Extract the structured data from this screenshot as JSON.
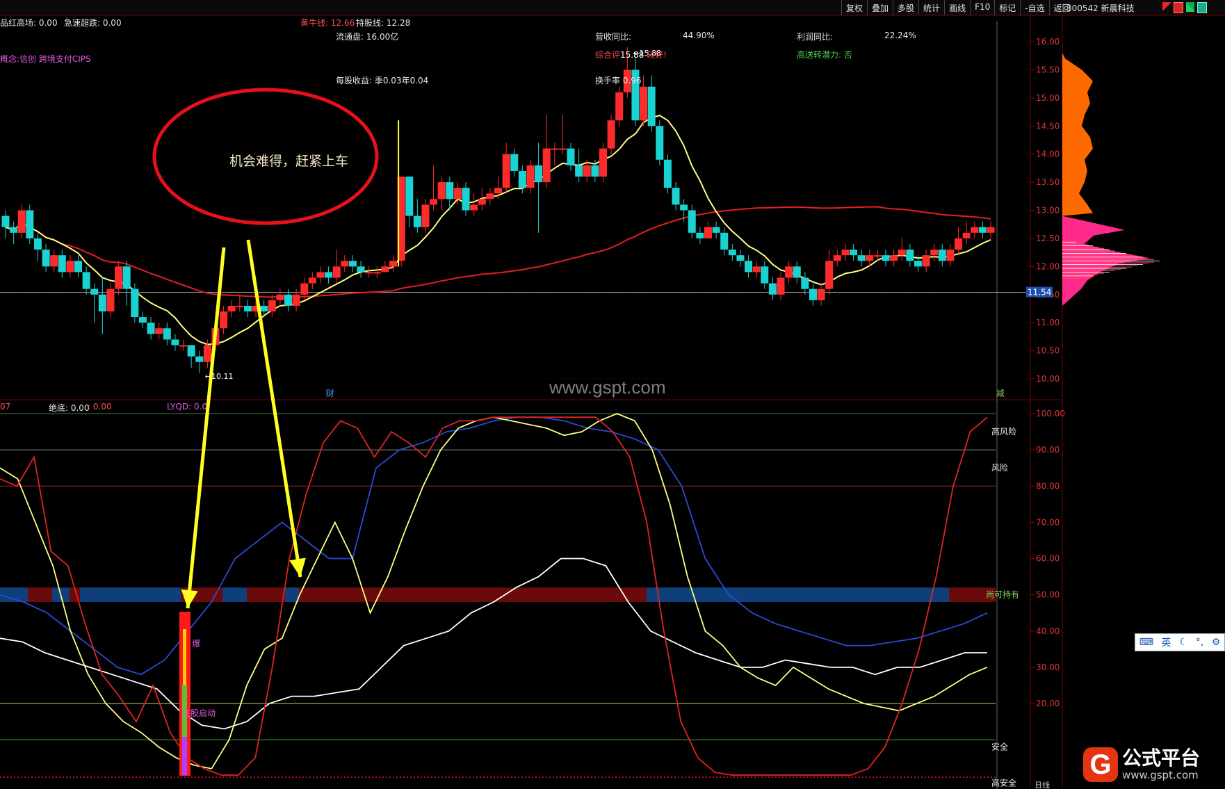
{
  "toolbar": {
    "buttons": [
      "复权",
      "叠加",
      "多股",
      "统计",
      "画线",
      "F10",
      "标记",
      "-自选",
      "返回"
    ],
    "stock_code": "300542",
    "stock_name": "新晨科技"
  },
  "info_panel": {
    "line1_a": "品红高场: 0.00",
    "line1_b": "急速超跌: 0.00",
    "huangniu": "黄牛线: 12.66",
    "chigu": "持股线: 12.28",
    "liutong": "流通盘: 16.00亿",
    "yingshou_label": "营收同比:",
    "yingshou_value": "44.90%",
    "lirun_label": "利润同比:",
    "lirun_value": "22.24%",
    "concept": "概念:信创 跨境支付CIPS",
    "zonghe": "综合评",
    "zonghe_val": "15.88",
    "zonghe_rest": "较好!",
    "gaosong": "高送转潜力: 否",
    "meigu": "每股收益: 季0.03年0.04",
    "huanshou": "换手率 0.96"
  },
  "annotation": {
    "ellipse_text": "机会难得，赶紧上车"
  },
  "watermark": "www.gspt.com",
  "logo": {
    "main": "公式平台",
    "sub": "www.gspt.com",
    "glyph": "G"
  },
  "ime": {
    "lang": "英"
  },
  "main_chart": {
    "price_labels": [
      "16.00",
      "15.50",
      "15.00",
      "14.50",
      "14.00",
      "13.50",
      "13.00",
      "12.50",
      "12.00",
      "11.50",
      "11.00",
      "10.50",
      "10.00"
    ],
    "current_price": "11.54",
    "low_marker": "←10.11",
    "high_marker": "←15.88",
    "event_cai": "财",
    "event_jian": "减"
  },
  "indicator_panel": {
    "header_a": "07",
    "header_b": "绝底: 0.00",
    "header_c": ": 0.00",
    "header_d": "LYQD: 0.0",
    "scale_labels": [
      "100.00",
      "90.00",
      "80.00",
      "70.00",
      "60.00",
      "50.00",
      "40.00",
      "30.00",
      "20.00"
    ],
    "zone_labels": [
      "高风险",
      "风险",
      "尚可持有",
      "安全",
      "高安全"
    ],
    "marker_bao": "爆",
    "marker_zhugu": "主股启动",
    "bottom_date": "日线"
  },
  "chart_data": {
    "type": "candlestick",
    "y_axis": {
      "min": 9.8,
      "max": 16.1,
      "unit": "price"
    },
    "candles": [
      [
        12.9,
        12.7,
        13.0,
        12.5
      ],
      [
        12.7,
        12.6,
        12.8,
        12.4
      ],
      [
        12.6,
        13.0,
        13.1,
        12.5
      ],
      [
        13.0,
        12.5,
        13.1,
        12.4
      ],
      [
        12.5,
        12.3,
        12.6,
        12.1
      ],
      [
        12.3,
        12.0,
        12.4,
        11.9
      ],
      [
        12.0,
        12.2,
        12.3,
        11.9
      ],
      [
        12.2,
        11.9,
        12.3,
        11.8
      ],
      [
        11.9,
        12.1,
        12.2,
        11.8
      ],
      [
        12.1,
        11.9,
        12.2,
        11.8
      ],
      [
        11.9,
        11.6,
        12.0,
        11.5
      ],
      [
        11.6,
        11.5,
        11.7,
        11.0
      ],
      [
        11.5,
        11.2,
        11.8,
        10.8
      ],
      [
        11.2,
        11.6,
        11.7,
        11.1
      ],
      [
        11.6,
        12.0,
        12.1,
        11.5
      ],
      [
        12.0,
        11.6,
        12.1,
        11.3
      ],
      [
        11.6,
        11.1,
        11.7,
        11.0
      ],
      [
        11.1,
        11.0,
        11.2,
        10.9
      ],
      [
        11.0,
        10.8,
        11.1,
        10.7
      ],
      [
        10.8,
        10.9,
        11.0,
        10.7
      ],
      [
        10.9,
        10.7,
        11.0,
        10.6
      ],
      [
        10.7,
        10.6,
        10.8,
        10.5
      ],
      [
        10.6,
        10.6,
        10.7,
        10.5
      ],
      [
        10.6,
        10.4,
        10.6,
        10.2
      ],
      [
        10.4,
        10.3,
        10.5,
        10.1
      ],
      [
        10.3,
        10.6,
        10.7,
        10.2
      ],
      [
        10.6,
        10.9,
        11.0,
        10.5
      ],
      [
        10.9,
        11.2,
        11.3,
        10.8
      ],
      [
        11.2,
        11.3,
        11.4,
        11.1
      ],
      [
        11.3,
        11.3,
        11.5,
        11.2
      ],
      [
        11.3,
        11.2,
        11.4,
        11.1
      ],
      [
        11.2,
        11.3,
        11.4,
        11.1
      ],
      [
        11.3,
        11.2,
        11.4,
        11.1
      ],
      [
        11.2,
        11.4,
        11.5,
        11.1
      ],
      [
        11.4,
        11.5,
        11.6,
        11.3
      ],
      [
        11.5,
        11.3,
        11.6,
        11.2
      ],
      [
        11.3,
        11.5,
        11.6,
        11.2
      ],
      [
        11.5,
        11.7,
        11.8,
        11.4
      ],
      [
        11.7,
        11.8,
        11.9,
        11.6
      ],
      [
        11.8,
        11.9,
        12.0,
        11.7
      ],
      [
        11.9,
        11.8,
        12.0,
        11.7
      ],
      [
        11.8,
        12.0,
        12.3,
        11.7
      ],
      [
        12.0,
        12.1,
        12.2,
        11.9
      ],
      [
        12.1,
        12.0,
        12.2,
        11.9
      ],
      [
        12.0,
        11.9,
        12.1,
        11.8
      ],
      [
        11.9,
        11.9,
        12.0,
        11.8
      ],
      [
        11.9,
        11.9,
        12.0,
        11.8
      ],
      [
        11.9,
        12.0,
        12.1,
        11.9
      ],
      [
        12.0,
        12.1,
        12.2,
        11.9
      ],
      [
        12.1,
        13.6,
        13.6,
        12.0
      ],
      [
        13.6,
        12.9,
        13.6,
        12.7
      ],
      [
        12.9,
        12.7,
        13.2,
        12.6
      ],
      [
        12.7,
        13.1,
        13.2,
        12.6
      ],
      [
        13.1,
        13.2,
        13.8,
        13.0
      ],
      [
        13.2,
        13.5,
        13.6,
        13.0
      ],
      [
        13.5,
        13.2,
        13.6,
        13.0
      ],
      [
        13.2,
        13.4,
        13.5,
        13.1
      ],
      [
        13.4,
        13.0,
        13.5,
        12.9
      ],
      [
        13.0,
        13.1,
        13.3,
        12.9
      ],
      [
        13.1,
        13.2,
        13.4,
        13.0
      ],
      [
        13.2,
        13.3,
        13.4,
        13.1
      ],
      [
        13.3,
        13.4,
        13.6,
        13.2
      ],
      [
        13.4,
        14.0,
        14.2,
        13.3
      ],
      [
        14.0,
        13.7,
        14.1,
        13.6
      ],
      [
        13.7,
        13.4,
        13.8,
        13.3
      ],
      [
        13.4,
        13.8,
        13.9,
        13.3
      ],
      [
        13.8,
        13.5,
        14.2,
        12.6
      ],
      [
        13.5,
        14.1,
        14.7,
        13.4
      ],
      [
        14.1,
        14.1,
        14.2,
        13.8
      ],
      [
        14.1,
        14.1,
        14.7,
        14.0
      ],
      [
        14.1,
        13.8,
        14.2,
        13.7
      ],
      [
        13.8,
        13.6,
        14.1,
        13.5
      ],
      [
        13.6,
        13.8,
        13.9,
        13.5
      ],
      [
        13.8,
        13.6,
        13.9,
        13.5
      ],
      [
        13.6,
        14.1,
        14.2,
        13.5
      ],
      [
        14.1,
        14.6,
        14.7,
        14.0
      ],
      [
        14.6,
        15.1,
        15.2,
        14.5
      ],
      [
        15.1,
        15.5,
        15.9,
        15.0
      ],
      [
        15.5,
        14.6,
        15.7,
        14.5
      ],
      [
        14.6,
        15.2,
        15.4,
        14.5
      ],
      [
        15.2,
        14.5,
        15.4,
        14.4
      ],
      [
        14.5,
        13.9,
        14.6,
        13.8
      ],
      [
        13.9,
        13.4,
        14.0,
        13.3
      ],
      [
        13.4,
        13.1,
        13.5,
        13.0
      ],
      [
        13.1,
        13.0,
        13.2,
        12.8
      ],
      [
        13.0,
        12.6,
        13.1,
        12.5
      ],
      [
        12.6,
        12.5,
        12.7,
        12.4
      ],
      [
        12.5,
        12.7,
        12.8,
        12.5
      ],
      [
        12.7,
        12.6,
        12.8,
        12.5
      ],
      [
        12.6,
        12.3,
        12.7,
        12.2
      ],
      [
        12.3,
        12.2,
        12.4,
        12.1
      ],
      [
        12.2,
        12.1,
        12.3,
        12.0
      ],
      [
        12.1,
        11.9,
        12.2,
        11.8
      ],
      [
        11.9,
        12.0,
        12.1,
        11.8
      ],
      [
        12.0,
        11.7,
        12.1,
        11.6
      ],
      [
        11.7,
        11.5,
        11.8,
        11.4
      ],
      [
        11.5,
        11.8,
        11.9,
        11.4
      ],
      [
        11.8,
        12.0,
        12.1,
        11.7
      ],
      [
        12.0,
        11.8,
        12.1,
        11.7
      ],
      [
        11.8,
        11.6,
        11.9,
        11.5
      ],
      [
        11.6,
        11.4,
        11.7,
        11.3
      ],
      [
        11.4,
        11.6,
        11.7,
        11.3
      ],
      [
        11.6,
        12.1,
        12.3,
        11.5
      ],
      [
        12.1,
        12.2,
        12.3,
        12.0
      ],
      [
        12.2,
        12.3,
        12.4,
        12.1
      ],
      [
        12.3,
        12.2,
        12.4,
        12.1
      ],
      [
        12.2,
        12.1,
        12.3,
        12.0
      ],
      [
        12.1,
        12.2,
        12.3,
        12.0
      ],
      [
        12.2,
        12.2,
        12.3,
        12.1
      ],
      [
        12.2,
        12.1,
        12.3,
        12.0
      ],
      [
        12.1,
        12.2,
        12.3,
        12.0
      ],
      [
        12.2,
        12.3,
        12.5,
        12.1
      ],
      [
        12.3,
        12.1,
        12.4,
        12.0
      ],
      [
        12.1,
        12.0,
        12.2,
        11.9
      ],
      [
        12.0,
        12.2,
        12.3,
        11.9
      ],
      [
        12.2,
        12.3,
        12.4,
        12.1
      ],
      [
        12.3,
        12.1,
        12.4,
        12.0
      ],
      [
        12.1,
        12.3,
        12.4,
        12.0
      ],
      [
        12.3,
        12.5,
        12.7,
        12.2
      ],
      [
        12.5,
        12.6,
        12.8,
        12.4
      ],
      [
        12.6,
        12.7,
        12.8,
        12.5
      ],
      [
        12.7,
        12.6,
        12.8,
        12.5
      ],
      [
        12.6,
        12.7,
        12.8,
        12.5
      ]
    ],
    "series": [
      {
        "name": "黄牛线",
        "color": "#ffff80"
      },
      {
        "name": "持股线",
        "color": "#e02020"
      }
    ],
    "indicator": {
      "y_axis": {
        "min": 0,
        "max": 100
      },
      "red": [
        82,
        80,
        88,
        62,
        58,
        42,
        28,
        22,
        15,
        25,
        12,
        5,
        2,
        0,
        0,
        5,
        30,
        60,
        78,
        92,
        98,
        96,
        88,
        95,
        92,
        88,
        96,
        98,
        98,
        99,
        99,
        99,
        99,
        99,
        99,
        99,
        95,
        88,
        70,
        40,
        15,
        5,
        1,
        0,
        0,
        0,
        0,
        0,
        0,
        0,
        0,
        2,
        8,
        20,
        35,
        55,
        80,
        95,
        99
      ],
      "yellow": [
        85,
        82,
        70,
        58,
        40,
        28,
        20,
        15,
        12,
        8,
        5,
        3,
        2,
        10,
        25,
        35,
        38,
        50,
        60,
        70,
        60,
        45,
        55,
        68,
        80,
        90,
        96,
        98,
        99,
        98,
        97,
        96,
        94,
        95,
        98,
        100,
        98,
        90,
        75,
        55,
        40,
        36,
        30,
        27,
        25,
        30,
        27,
        24,
        22,
        20,
        19,
        18,
        20,
        22,
        25,
        28,
        30
      ],
      "white": [
        38,
        37,
        34,
        32,
        30,
        28,
        26,
        24,
        18,
        14,
        13,
        15,
        20,
        22,
        22,
        23,
        24,
        30,
        36,
        38,
        40,
        45,
        48,
        52,
        55,
        60,
        60,
        58,
        48,
        40,
        37,
        34,
        32,
        30,
        30,
        32,
        31,
        30,
        30,
        28,
        30,
        30,
        32,
        34,
        34
      ],
      "blue": [
        50,
        48,
        45,
        40,
        35,
        30,
        28,
        32,
        40,
        48,
        60,
        65,
        70,
        65,
        60,
        60,
        85,
        90,
        92,
        95,
        96,
        98,
        99,
        99,
        98,
        96,
        95,
        93,
        90,
        80,
        60,
        50,
        45,
        42,
        40,
        38,
        36,
        36,
        37,
        38,
        40,
        42,
        45
      ]
    }
  }
}
